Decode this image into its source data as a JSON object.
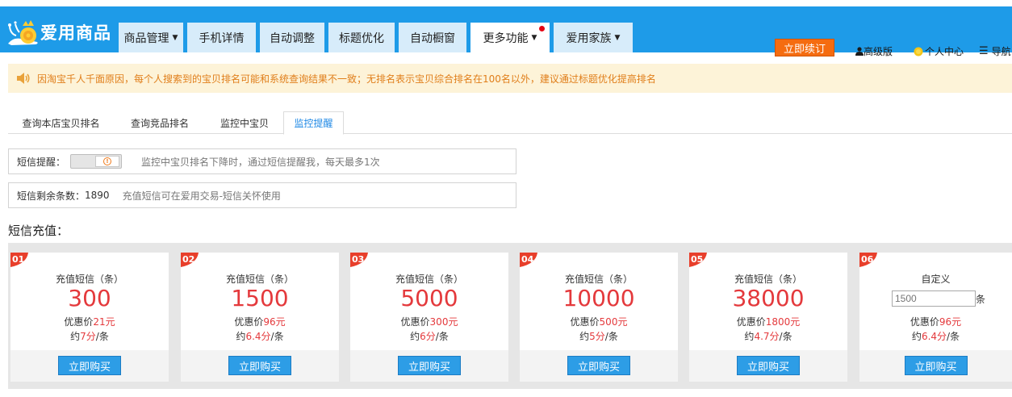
{
  "brand": {
    "name": "爱用商品"
  },
  "nav": [
    {
      "label": "商品管理",
      "caret": true,
      "active": false,
      "dot": false
    },
    {
      "label": "手机详情",
      "caret": false,
      "active": false,
      "dot": false
    },
    {
      "label": "自动调整",
      "caret": false,
      "active": false,
      "dot": false
    },
    {
      "label": "标题优化",
      "caret": false,
      "active": false,
      "dot": false
    },
    {
      "label": "自动橱窗",
      "caret": false,
      "active": false,
      "dot": false
    },
    {
      "label": "更多功能",
      "caret": true,
      "active": true,
      "dot": true
    },
    {
      "label": "爱用家族",
      "caret": true,
      "active": false,
      "dot": false
    }
  ],
  "header": {
    "renew_label": "立即续订",
    "version_label": "高级版",
    "user_center_label": "个人中心",
    "nav_label": "导航"
  },
  "notice": {
    "text": "因淘宝千人千面原因，每个人搜索到的宝贝排名可能和系统查询结果不一致；无排名表示宝贝综合排名在100名以外，建议通过标题优化提高排名"
  },
  "tabs": [
    {
      "label": "查询本店宝贝排名",
      "active": false
    },
    {
      "label": "查询竞品排名",
      "active": false
    },
    {
      "label": "监控中宝贝",
      "active": false
    },
    {
      "label": "监控提醒",
      "active": true
    }
  ],
  "sms_alert": {
    "label": "短信提醒：",
    "desc": "监控中宝贝排名下降时，通过短信提醒我，每天最多1次"
  },
  "sms_balance": {
    "label": "短信剩余条数：",
    "count": "1890",
    "desc": "充值短信可在爱用交易-短信关怀使用"
  },
  "recharge": {
    "title": "短信充值：",
    "buy_label": "立即购买",
    "cards": [
      {
        "num": "01",
        "sub": "充值短信（条）",
        "amount": "300",
        "price_prefix": "优惠价",
        "price": "21元",
        "unit_prefix": "约",
        "unit": "7分",
        "unit_suffix": "/条"
      },
      {
        "num": "02",
        "sub": "充值短信（条）",
        "amount": "1500",
        "price_prefix": "优惠价",
        "price": "96元",
        "unit_prefix": "约",
        "unit": "6.4分",
        "unit_suffix": "/条"
      },
      {
        "num": "03",
        "sub": "充值短信（条）",
        "amount": "5000",
        "price_prefix": "优惠价",
        "price": "300元",
        "unit_prefix": "约",
        "unit": "6分",
        "unit_suffix": "/条"
      },
      {
        "num": "04",
        "sub": "充值短信（条）",
        "amount": "10000",
        "price_prefix": "优惠价",
        "price": "500元",
        "unit_prefix": "约",
        "unit": "5分",
        "unit_suffix": "/条"
      },
      {
        "num": "05",
        "sub": "充值短信（条）",
        "amount": "38000",
        "price_prefix": "优惠价",
        "price": "1800元",
        "unit_prefix": "约",
        "unit": "4.7分",
        "unit_suffix": "/条"
      }
    ],
    "custom": {
      "num": "06",
      "title": "自定义",
      "placeholder": "1500",
      "unit_label": "条",
      "price_prefix": "优惠价",
      "price": "96元",
      "unit_prefix": "约",
      "unit": "6.4分",
      "unit_suffix": "/条"
    }
  },
  "colors": {
    "header_bg": "#1e9be8",
    "accent_red": "#e4393c",
    "button_blue": "#2d9de6",
    "renew_orange": "#f56c10",
    "notice_text": "#e07e1a"
  }
}
